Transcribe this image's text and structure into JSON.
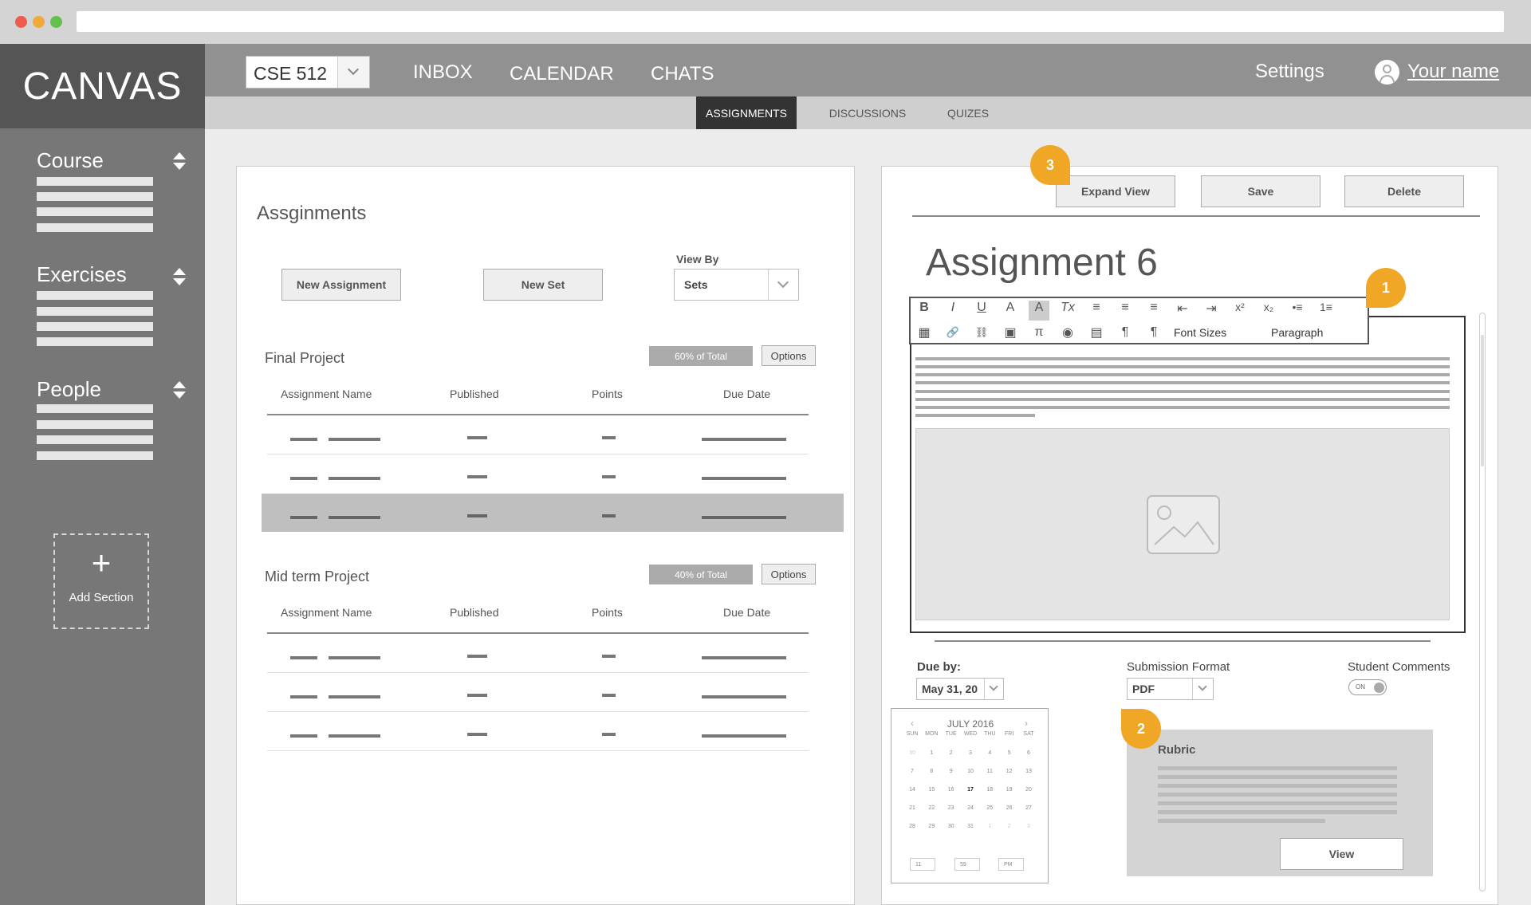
{
  "app": {
    "brand": "CANVAS"
  },
  "sidebar": {
    "sections": [
      {
        "label": "Course"
      },
      {
        "label": "Exercises"
      },
      {
        "label": "People"
      }
    ],
    "add_section": "Add Section",
    "add_glyph": "+"
  },
  "topnav": {
    "course": "CSE 512",
    "links": [
      "INBOX",
      "CALENDAR",
      "CHATS"
    ],
    "settings": "Settings",
    "user": "Your name"
  },
  "subnav": {
    "tabs": [
      "ASSIGNMENTS",
      "DISCUSSIONS",
      "QUIZES"
    ],
    "active": "ASSIGNMENTS"
  },
  "left": {
    "title": "Assginments",
    "new_assignment": "New Assignment",
    "new_set": "New Set",
    "view_by_label": "View By",
    "view_by_value": "Sets",
    "columns": [
      "Assignment Name",
      "Published",
      "Points",
      "Due Date"
    ],
    "groups": [
      {
        "title": "Final Project",
        "percent": "60% of Total",
        "options": "Options",
        "rows": 3,
        "highlight_row": 3
      },
      {
        "title": "Mid term Project",
        "percent": "40% of Total",
        "options": "Options",
        "rows": 3,
        "highlight_row": 0
      }
    ]
  },
  "right": {
    "expand": "Expand View",
    "save": "Save",
    "delete": "Delete",
    "heading": "Assignment 6",
    "toolbar": {
      "font_sizes": "Font Sizes",
      "paragraph": "Paragraph",
      "row1": [
        "B",
        "I",
        "U",
        "A",
        "A",
        "Tx",
        "≡",
        "≡",
        "≡",
        "⇤",
        "⇥",
        "x²",
        "x₂",
        "•≡",
        "1≡"
      ],
      "row2": [
        "▦",
        "🔗",
        "⛓",
        "▣",
        "π",
        "◉",
        "▤",
        "¶",
        "¶"
      ]
    },
    "due_label": "Due by:",
    "due_value": "May 31, 20",
    "format_label": "Submission Format",
    "format_value": "PDF",
    "comments_label": "Student Comments",
    "toggle": "ON",
    "calendar": {
      "month": "JULY 2016",
      "days": [
        "SUN",
        "MON",
        "TUE",
        "WED",
        "THU",
        "FRI",
        "SAT"
      ],
      "weeks": [
        [
          "30",
          "1",
          "2",
          "3",
          "4",
          "5",
          "6"
        ],
        [
          "7",
          "8",
          "9",
          "10",
          "11",
          "12",
          "13"
        ],
        [
          "14",
          "15",
          "16",
          "17",
          "18",
          "19",
          "20"
        ],
        [
          "21",
          "22",
          "23",
          "24",
          "25",
          "26",
          "27"
        ],
        [
          "28",
          "29",
          "30",
          "31",
          "1",
          "2",
          "3"
        ]
      ],
      "hour": "11",
      "minute": "59",
      "ampm": "PM"
    },
    "rubric": {
      "title": "Rubric",
      "view": "View"
    }
  },
  "badges": [
    "1",
    "2",
    "3"
  ]
}
